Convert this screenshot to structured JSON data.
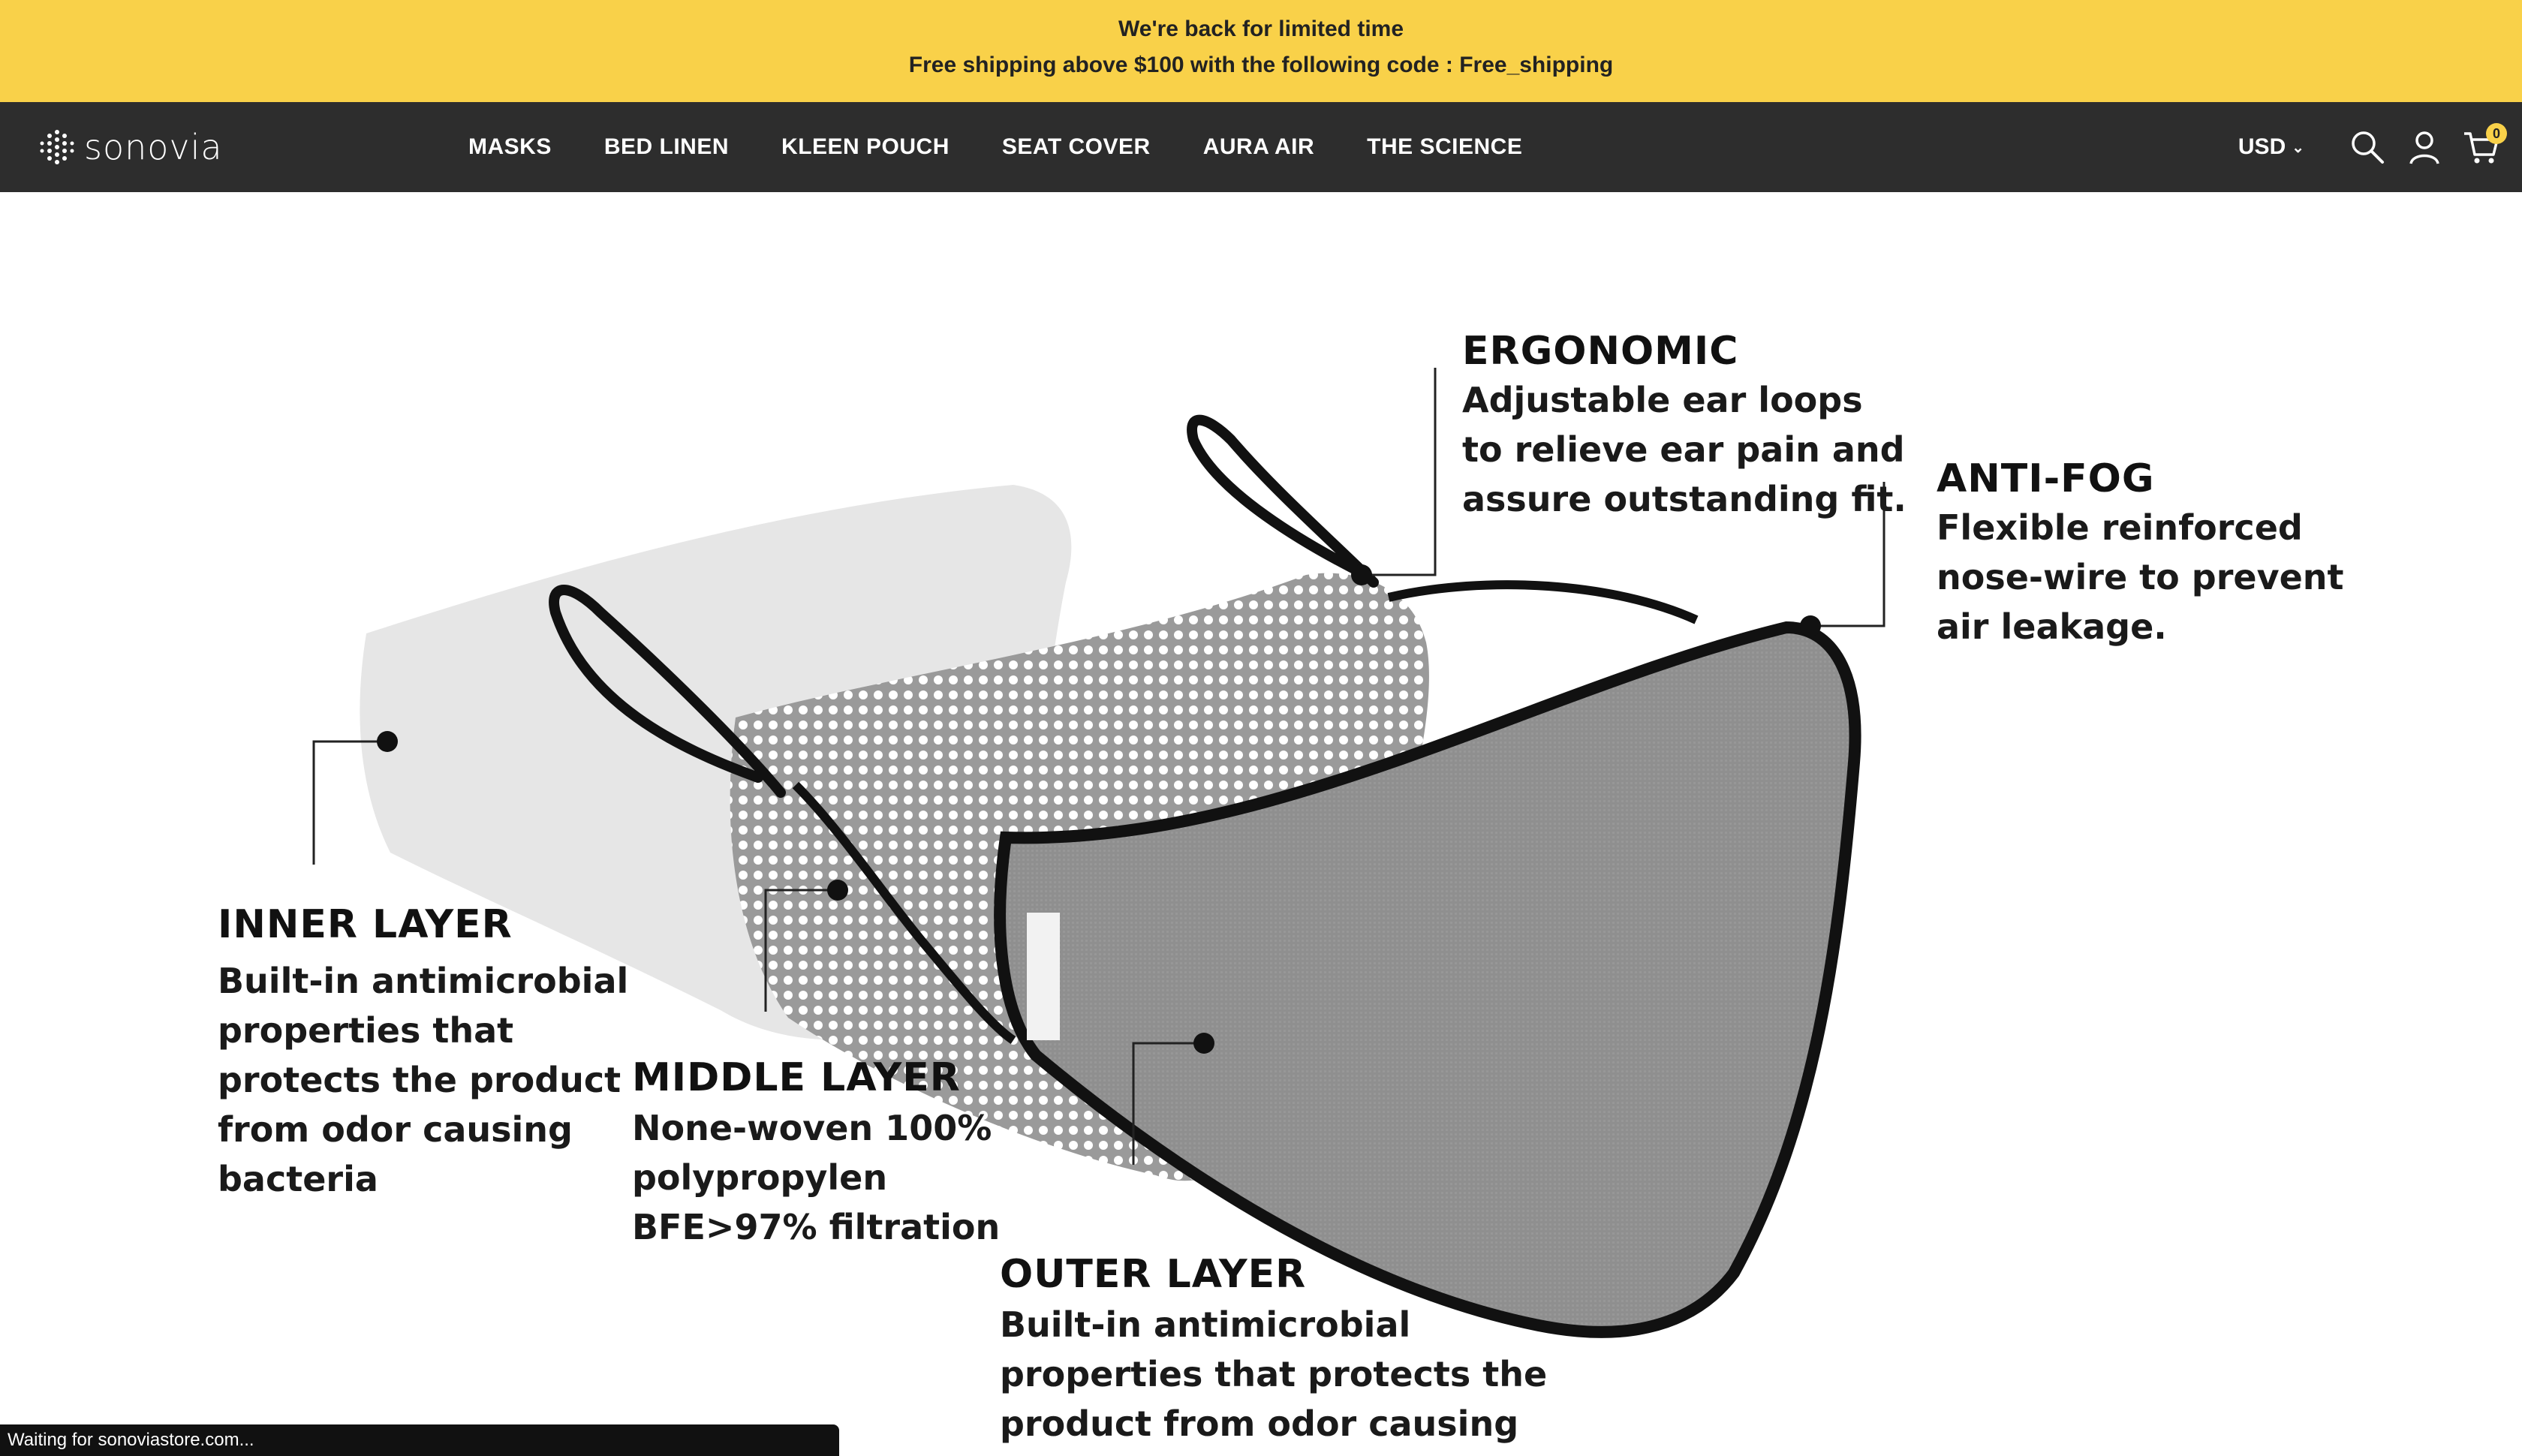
{
  "announcement": {
    "line1": "We're back for limited time",
    "line2": "Free shipping above $100 with the following code : Free_shipping"
  },
  "header": {
    "logo_text": "sonovia",
    "menu": [
      {
        "label": "MASKS"
      },
      {
        "label": "BED LINEN"
      },
      {
        "label": "KLEEN POUCH"
      },
      {
        "label": "SEAT COVER"
      },
      {
        "label": "AURA AIR"
      },
      {
        "label": "THE SCIENCE"
      }
    ],
    "currency": "USD",
    "icons": [
      "search-icon",
      "account-icon",
      "cart-icon"
    ],
    "cart_count": "0"
  },
  "features": {
    "inner": {
      "title": "INNER LAYER",
      "lines": [
        "Built-in antimicrobial",
        "properties that",
        "protects the product",
        "from odor causing",
        "bacteria"
      ]
    },
    "middle": {
      "title": "MIDDLE LAYER",
      "lines": [
        "None-woven 100%",
        "polypropylen",
        "BFE>97% filtration"
      ]
    },
    "outer": {
      "title": "OUTER LAYER",
      "lines": [
        "Built-in antimicrobial",
        "properties that protects the",
        "product from odor causing"
      ]
    },
    "ergonomic": {
      "title": "ERGONOMIC",
      "lines": [
        "Adjustable ear loops",
        "to relieve ear pain and",
        "assure outstanding fit."
      ]
    },
    "antifog": {
      "title": "ANTI-FOG",
      "lines": [
        "Flexible reinforced",
        "nose-wire to prevent",
        "air leakage."
      ]
    }
  },
  "status_bar": "Waiting for sonoviastore.com...",
  "colors": {
    "announcement_bg": "#f9d149",
    "nav_bg": "#2d2d2d",
    "mask_outer": "#8e8e8e",
    "mask_inner": "#e3e3e3"
  }
}
